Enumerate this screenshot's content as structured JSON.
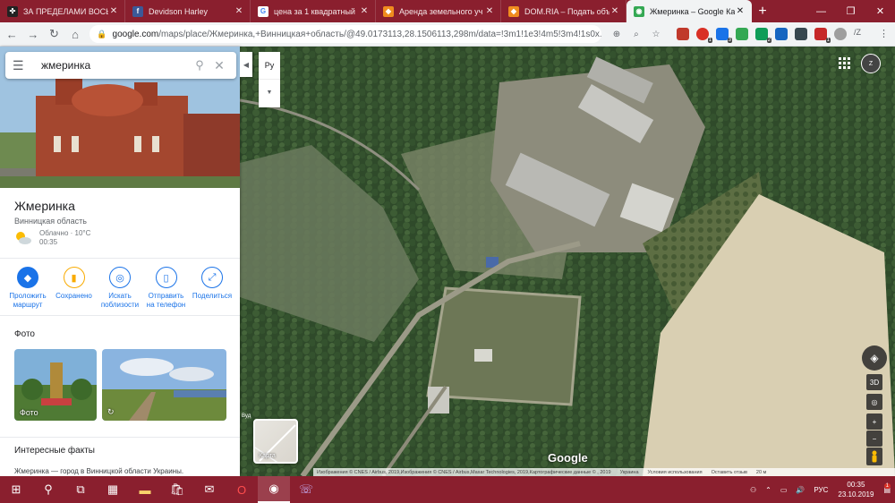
{
  "browser": {
    "tabs": [
      {
        "label": "ЗА ПРЕДЕЛАМИ ВОСЬ",
        "icon": "dg-icon",
        "color": "#222222",
        "active": false
      },
      {
        "label": "Devidson Harley",
        "icon": "facebook-icon",
        "color": "#3b5998",
        "active": false
      },
      {
        "label": "цена за 1 квадратный",
        "icon": "google-icon",
        "color": "#ffffff",
        "active": false
      },
      {
        "label": "Аренда земельного уч",
        "icon": "domria-icon",
        "color": "#f08c1e",
        "active": false
      },
      {
        "label": "DOM.RIA – Подать объ",
        "icon": "domria-icon",
        "color": "#f08c1e",
        "active": false
      },
      {
        "label": "Жмеринка – Google Ка",
        "icon": "maps-icon",
        "color": "#34a853",
        "active": true
      }
    ],
    "url_host": "google.com",
    "url_path": "/maps/place/Жмеринка,+Винницкая+область/@49.0173113,28.1506113,298m/data=!3m1!1e3!4m5!3m4!1s0x..."
  },
  "panel": {
    "search_value": "жмеринка",
    "place_title": "Жмеринка",
    "region": "Винницкая область",
    "weather_line1": "Облачно · 10°C",
    "weather_line2": "00:35",
    "actions": [
      {
        "label": "Проложить маршрут",
        "icon": "directions-icon"
      },
      {
        "label": "Сохранено",
        "icon": "bookmark-icon"
      },
      {
        "label": "Искать поблизости",
        "icon": "nearby-icon"
      },
      {
        "label": "Отправить на телефон",
        "icon": "send-to-phone-icon"
      },
      {
        "label": "Поделиться",
        "icon": "share-icon"
      }
    ],
    "photos_heading": "Фото",
    "photo_caption": "Фото",
    "facts_heading": "Интересные факты",
    "facts_text": "Жмеринка — город в Винницкой области Украины."
  },
  "map": {
    "lang_label": "Ру",
    "minimap_label": "Карта",
    "google_label": "Google",
    "control_3d": "3D",
    "scale_text": "Вуд",
    "attribution": [
      "Изображения © CNES / Airbus, 2019,Изображения © CNES / Airbus,Maxar Technologies, 2019,Картографические данные © , 2019",
      "Украина",
      "Условия использования",
      "Оставить отзыв",
      "20 м"
    ]
  },
  "taskbar": {
    "lang": "РУС",
    "time": "00:35",
    "date": "23.10.2019",
    "notify_count": "1"
  }
}
